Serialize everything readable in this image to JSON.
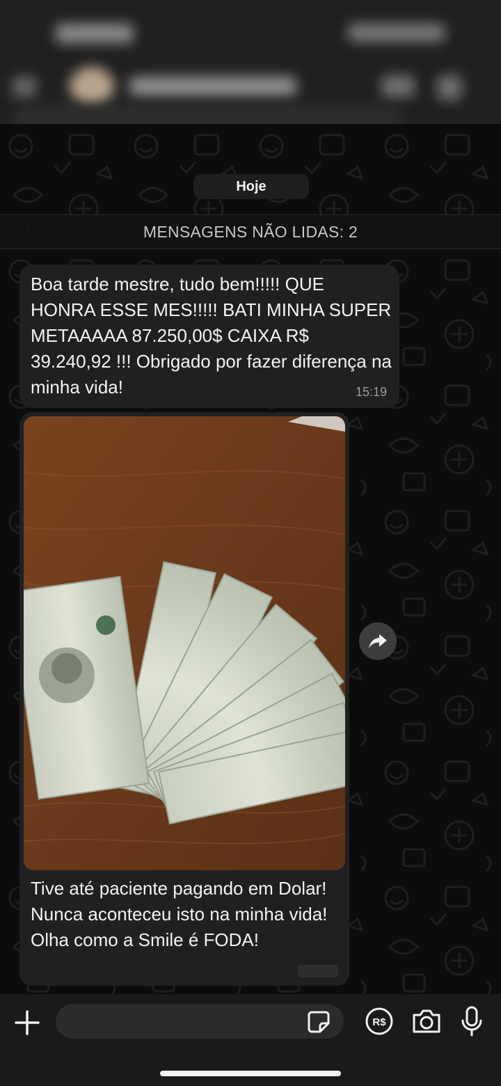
{
  "chat": {
    "date_label": "Hoje",
    "unread_banner": "MENSAGENS NÃO LIDAS: 2"
  },
  "messages": [
    {
      "text": "Boa tarde mestre, tudo bem!!!!! QUE HONRA ESSE MES!!!!! BATI MINHA SUPER METAAAAA 87.250,00$ CAIXA R$  39.240,92 !!! Obrigado por fazer diferença na minha vida!",
      "time": "15:19"
    },
    {
      "caption": "Tive até paciente pagando em Dolar! Nunca aconteceu isto na minha vida! Olha como a Smile é FODA!"
    }
  ],
  "colors": {
    "bubble": "#1f2021",
    "background": "#0c0c0c",
    "table_wood": "#6b3b1d"
  },
  "icons": {
    "forward": "forward-arrow-icon",
    "plus": "plus-icon",
    "sticker": "sticker-icon",
    "pix": "brl-payment-icon",
    "camera": "camera-icon",
    "mic": "microphone-icon"
  }
}
